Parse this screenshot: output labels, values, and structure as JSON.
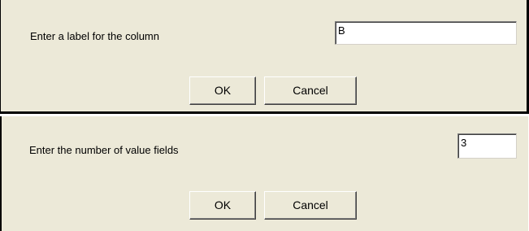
{
  "column_label_dialog": {
    "prompt": "Enter a label for the column",
    "input_value": "B",
    "ok_label": "OK",
    "cancel_label": "Cancel"
  },
  "value_fields_dialog": {
    "prompt": "Enter the number of value fields",
    "input_value": "3",
    "ok_label": "OK",
    "cancel_label": "Cancel"
  },
  "colors": {
    "dialog_background": "#ece9d8",
    "field_background": "#ffffff",
    "border_dark": "#000000"
  }
}
